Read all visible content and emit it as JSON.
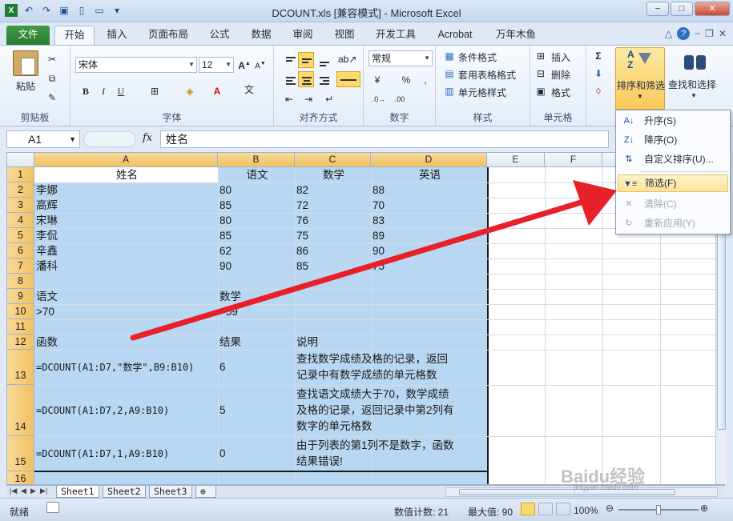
{
  "window": {
    "title": "DCOUNT.xls  [兼容模式]  - Microsoft Excel",
    "controls": [
      "−",
      "□",
      "✕"
    ]
  },
  "ribbon_tabs": [
    "文件",
    "开始",
    "插入",
    "页面布局",
    "公式",
    "数据",
    "审阅",
    "视图",
    "开发工具",
    "Acrobat",
    "万年木鱼"
  ],
  "active_tab": "开始",
  "ribbon": {
    "clipboard": {
      "paste": "粘贴",
      "group": "剪贴板"
    },
    "font": {
      "name": "宋体",
      "size": "12",
      "group": "字体",
      "bold": "B",
      "italic": "I",
      "underline": "U"
    },
    "alignment": {
      "group": "对齐方式"
    },
    "number": {
      "format": "常规",
      "percent": "%",
      "comma": ",",
      "group": "数字"
    },
    "styles": {
      "conditional": "条件格式",
      "table": "套用表格格式",
      "cell": "单元格样式",
      "group": "样式"
    },
    "cells": {
      "insert": "插入",
      "delete": "删除",
      "format": "格式",
      "group": "单元格"
    },
    "editing": {
      "sum": "Σ",
      "sort_filter": "排序和筛选",
      "find_select": "查找和选择"
    }
  },
  "formula_bar": {
    "name_box": "A1",
    "fx": "fx",
    "value": "姓名"
  },
  "columns": [
    "A",
    "B",
    "C",
    "D",
    "E",
    "F"
  ],
  "rows": [
    "1",
    "2",
    "3",
    "4",
    "5",
    "6",
    "7",
    "8",
    "9",
    "10",
    "11",
    "12",
    "13",
    "14",
    "15",
    "16"
  ],
  "cells": {
    "r1": [
      "姓名",
      "语文",
      "数学",
      "英语"
    ],
    "r2": [
      "李娜",
      "80",
      "82",
      "88"
    ],
    "r3": [
      "高辉",
      "85",
      "72",
      "70"
    ],
    "r4": [
      "宋琳",
      "80",
      "76",
      "83"
    ],
    "r5": [
      "李侃",
      "85",
      "75",
      "89"
    ],
    "r6": [
      "辛鑫",
      "62",
      "86",
      "90"
    ],
    "r7": [
      "潘科",
      "90",
      "85",
      "75"
    ],
    "r9": [
      "语文",
      "数学"
    ],
    "r10": [
      ">70",
      ">59"
    ],
    "r12": [
      "函数",
      "结果",
      "说明"
    ],
    "r13": [
      "=DCOUNT(A1:D7,\"数学\",B9:B10)",
      "6",
      "查找数学成绩及格的记录，返回",
      "记录中有数学成绩的单元格数"
    ],
    "r14": [
      "=DCOUNT(A1:D7,2,A9:B10)",
      "5",
      "查找语文成绩大于70，数学成绩",
      "及格的记录，返回记录中第2列有",
      "数字的单元格数"
    ],
    "r15": [
      "=DCOUNT(A1:D7,1,A9:B10)",
      "0",
      "由于列表的第1列不是数字，函数",
      "结果错误!"
    ]
  },
  "sheets": [
    "Sheet1",
    "Sheet2",
    "Sheet3"
  ],
  "active_sheet": "Sheet1",
  "status": {
    "ready": "就绪",
    "count": "数值计数: 21",
    "max": "最大值: 90",
    "zoom": "100%",
    "zoom_level": 0.5
  },
  "sort_menu": {
    "items": [
      {
        "label": "升序(S)",
        "icon": "sort-ascending-icon",
        "enabled": true
      },
      {
        "label": "降序(O)",
        "icon": "sort-descending-icon",
        "enabled": true
      },
      {
        "label": "自定义排序(U)...",
        "icon": "custom-sort-icon",
        "enabled": true
      },
      {
        "label": "筛选(F)",
        "icon": "filter-icon",
        "enabled": true,
        "highlighted": true
      },
      {
        "label": "清除(C)",
        "icon": "clear-filter-icon",
        "enabled": false
      },
      {
        "label": "重新应用(Y)",
        "icon": "reapply-icon",
        "enabled": false
      }
    ]
  },
  "watermark": "Baidu经验",
  "watermark_url": "jingyan.baidu.com",
  "colors": {
    "accent_green": "#2a7b30",
    "selection": "#b8d7f3",
    "arrow_red": "#e8202a",
    "highlight": "#fde39a"
  }
}
